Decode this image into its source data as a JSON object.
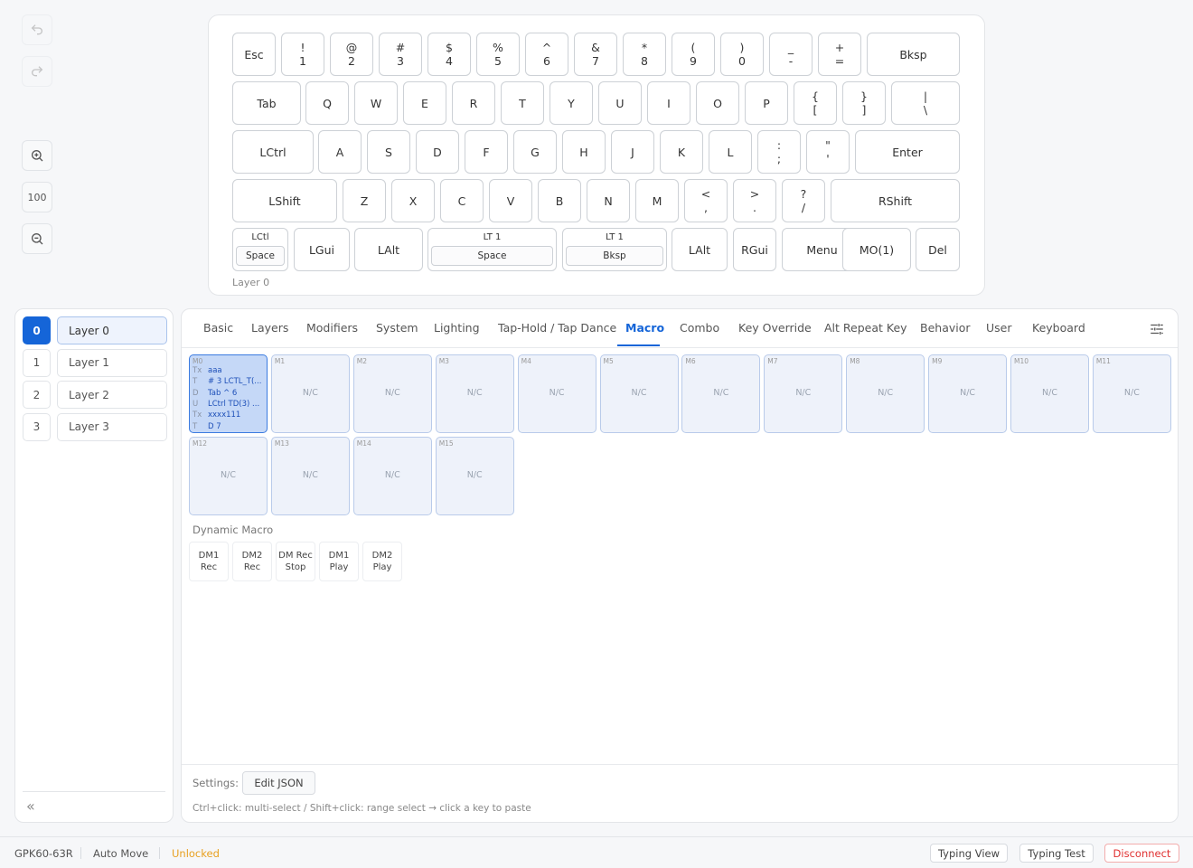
{
  "tools": {
    "undo_icon": "undo-icon",
    "redo_icon": "redo-icon",
    "zoom_in_icon": "zoom-in-icon",
    "zoom_level": "100",
    "zoom_out_icon": "zoom-out-icon"
  },
  "keyboard": {
    "layer_label": "Layer 0",
    "rows": [
      [
        {
          "label": "Esc"
        },
        {
          "top": "!",
          "bottom": "1"
        },
        {
          "top": "@",
          "bottom": "2"
        },
        {
          "top": "#",
          "bottom": "3"
        },
        {
          "top": "$",
          "bottom": "4"
        },
        {
          "top": "%",
          "bottom": "5"
        },
        {
          "top": "^",
          "bottom": "6"
        },
        {
          "top": "&",
          "bottom": "7"
        },
        {
          "top": "*",
          "bottom": "8"
        },
        {
          "top": "(",
          "bottom": "9"
        },
        {
          "top": ")",
          "bottom": "0"
        },
        {
          "top": "_",
          "bottom": "-"
        },
        {
          "top": "+",
          "bottom": "="
        },
        {
          "label": "Bksp"
        }
      ],
      [
        {
          "label": "Tab"
        },
        {
          "label": "Q"
        },
        {
          "label": "W"
        },
        {
          "label": "E"
        },
        {
          "label": "R"
        },
        {
          "label": "T"
        },
        {
          "label": "Y"
        },
        {
          "label": "U"
        },
        {
          "label": "I"
        },
        {
          "label": "O"
        },
        {
          "label": "P"
        },
        {
          "top": "{",
          "bottom": "["
        },
        {
          "top": "}",
          "bottom": "]"
        },
        {
          "top": "|",
          "bottom": "\\"
        }
      ],
      [
        {
          "label": "LCtrl"
        },
        {
          "label": "A"
        },
        {
          "label": "S"
        },
        {
          "label": "D"
        },
        {
          "label": "F"
        },
        {
          "label": "G"
        },
        {
          "label": "H"
        },
        {
          "label": "J"
        },
        {
          "label": "K"
        },
        {
          "label": "L"
        },
        {
          "top": ":",
          "bottom": ";"
        },
        {
          "top": "\"",
          "bottom": "'"
        },
        {
          "label": "Enter"
        }
      ],
      [
        {
          "label": "LShift"
        },
        {
          "label": "Z"
        },
        {
          "label": "X"
        },
        {
          "label": "C"
        },
        {
          "label": "V"
        },
        {
          "label": "B"
        },
        {
          "label": "N"
        },
        {
          "label": "M"
        },
        {
          "top": "<",
          "bottom": ","
        },
        {
          "top": ">",
          "bottom": "."
        },
        {
          "top": "?",
          "bottom": "/"
        },
        {
          "label": "RShift"
        }
      ],
      [
        {
          "title": "LCtl",
          "inner": "Space"
        },
        {
          "label": "LGui"
        },
        {
          "label": "LAlt"
        },
        {
          "title": "LT 1",
          "inner": "Space"
        },
        {
          "title": "LT 1",
          "inner": "Bksp"
        },
        {
          "label": "LAlt"
        },
        {
          "label": "RGui"
        },
        {
          "label": "Menu"
        },
        {
          "label": "MO(1)"
        },
        {
          "label": "Del"
        }
      ]
    ]
  },
  "layers": [
    {
      "num": "0",
      "name": "Layer 0",
      "active": true
    },
    {
      "num": "1",
      "name": "Layer 1",
      "active": false
    },
    {
      "num": "2",
      "name": "Layer 2",
      "active": false
    },
    {
      "num": "3",
      "name": "Layer 3",
      "active": false
    }
  ],
  "collapse_label": "«",
  "tabs": [
    "Basic",
    "Layers",
    "Modifiers",
    "System",
    "Lighting",
    "Tap-Hold / Tap Dance",
    "Macro",
    "Combo",
    "Key Override",
    "Alt Repeat Key",
    "Behavior",
    "User",
    "Keyboard"
  ],
  "active_tab": "Macro",
  "settings_icon": "tune-icon",
  "macros": [
    {
      "id": "M0",
      "active": true,
      "lines": [
        {
          "t": "Tx",
          "v": "aaa"
        },
        {
          "t": "T",
          "v": "# 3 LCTL_T(..."
        },
        {
          "t": "D",
          "v": "Tab ^ 6"
        },
        {
          "t": "U",
          "v": "LCtrl TD(3) ..."
        },
        {
          "t": "Tx",
          "v": "xxxx111"
        },
        {
          "t": "T",
          "v": "D 7"
        }
      ]
    },
    {
      "id": "M1",
      "text": "N/C"
    },
    {
      "id": "M2",
      "text": "N/C"
    },
    {
      "id": "M3",
      "text": "N/C"
    },
    {
      "id": "M4",
      "text": "N/C"
    },
    {
      "id": "M5",
      "text": "N/C"
    },
    {
      "id": "M6",
      "text": "N/C"
    },
    {
      "id": "M7",
      "text": "N/C"
    },
    {
      "id": "M8",
      "text": "N/C"
    },
    {
      "id": "M9",
      "text": "N/C"
    },
    {
      "id": "M10",
      "text": "N/C"
    },
    {
      "id": "M11",
      "text": "N/C"
    },
    {
      "id": "M12",
      "text": "N/C"
    },
    {
      "id": "M13",
      "text": "N/C"
    },
    {
      "id": "M14",
      "text": "N/C"
    },
    {
      "id": "M15",
      "text": "N/C"
    }
  ],
  "dynamic_macro": {
    "title": "Dynamic Macro",
    "keys": [
      [
        "DM1",
        "Rec"
      ],
      [
        "DM2",
        "Rec"
      ],
      [
        "DM Rec",
        "Stop"
      ],
      [
        "DM1",
        "Play"
      ],
      [
        "DM2",
        "Play"
      ]
    ]
  },
  "settings": {
    "label": "Settings:",
    "edit_json": "Edit JSON",
    "hint": "Ctrl+click: multi-select / Shift+click: range select → click a key to paste"
  },
  "status": {
    "device": "GPK60-63R",
    "auto_move": "Auto Move",
    "lock_state": "Unlocked",
    "lock_color": "#e8a020",
    "typing_view": "Typing View",
    "typing_test": "Typing Test",
    "disconnect": "Disconnect",
    "disconnect_color": "#e03131"
  }
}
